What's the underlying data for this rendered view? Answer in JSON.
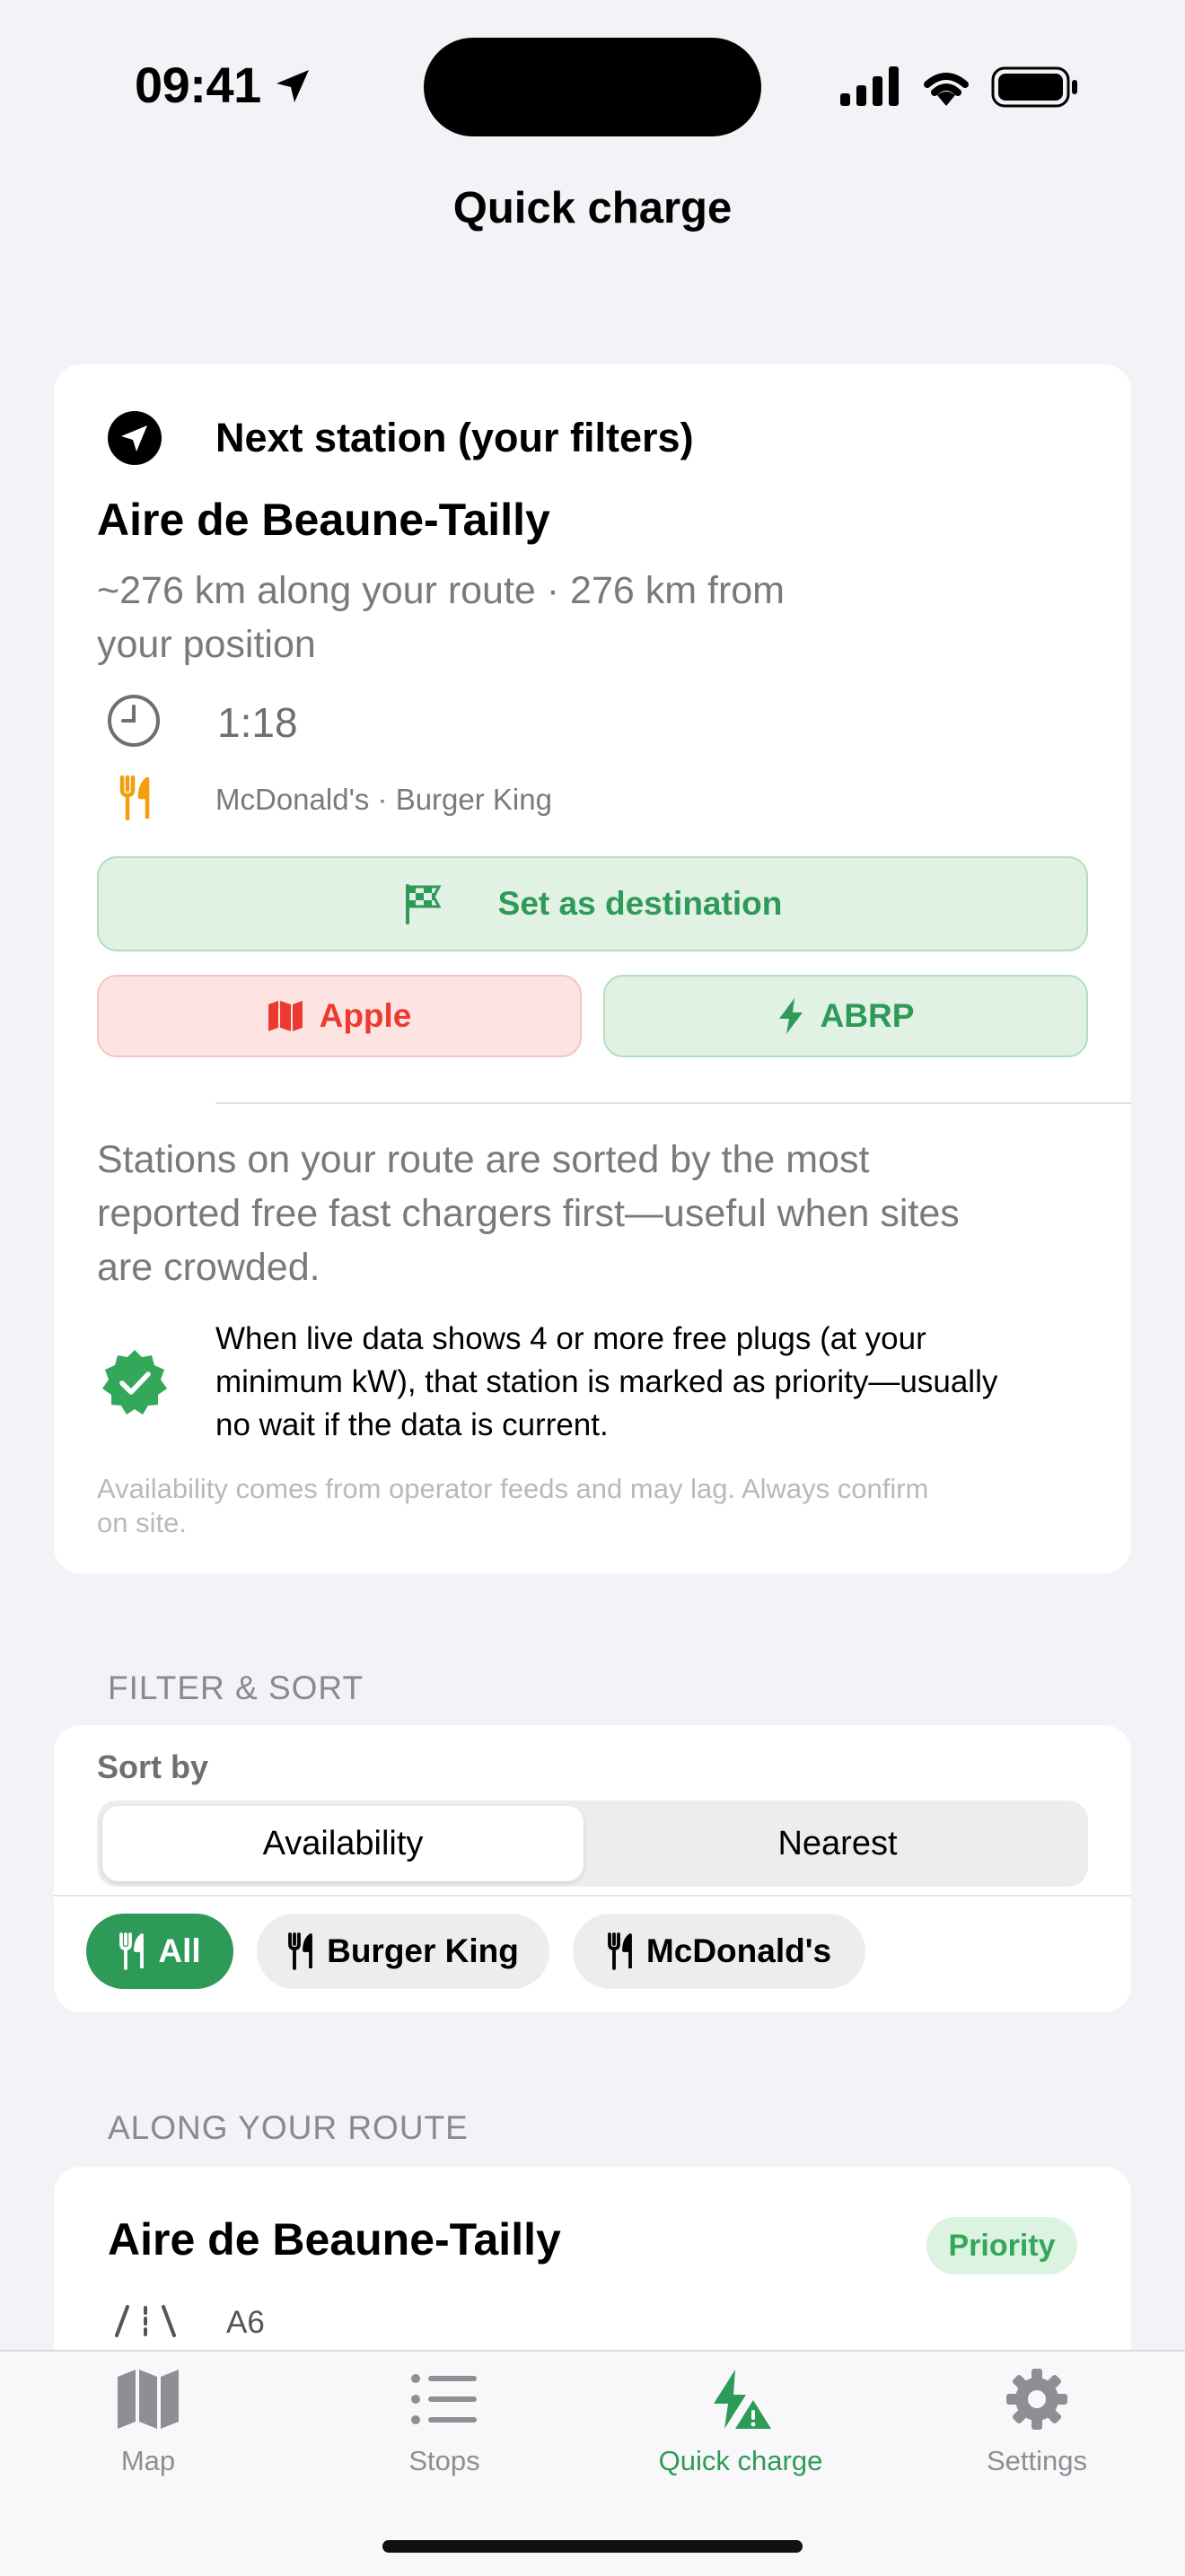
{
  "status_bar": {
    "time": "09:41"
  },
  "nav": {
    "title": "Quick charge"
  },
  "next_station": {
    "header": "Next station (your filters)",
    "name": "Aire de Beaune-Tailly",
    "distance_line1": "~276 km along your route · 276 km from",
    "distance_line2": "your position",
    "time": "1:18",
    "food": "McDonald's · Burger King",
    "set_destination_label": "Set as destination",
    "apple_label": "Apple",
    "abrp_label": "ABRP",
    "explain_line1": "Stations on your route are sorted by the most",
    "explain_line2": "reported free fast chargers first—useful when sites",
    "explain_line3": "are crowded.",
    "priority_line1": "When live data shows 4 or more free plugs (at your",
    "priority_line2": "minimum kW), that station is marked as priority—usually",
    "priority_line3": "no wait if the data is current.",
    "fine_line1": "Availability comes from operator feeds and may lag. Always confirm",
    "fine_line2": "on site."
  },
  "filter_sort": {
    "section_label": "FILTER & SORT",
    "sort_by_label": "Sort by",
    "sort_options": [
      "Availability",
      "Nearest"
    ],
    "selected_sort": "Availability",
    "chips": [
      "All",
      "Burger King",
      "McDonald's"
    ],
    "selected_chip": "All"
  },
  "route": {
    "section_label": "ALONG YOUR ROUTE",
    "stations": [
      {
        "name": "Aire de Beaune-Tailly",
        "badge": "Priority",
        "road": "A6"
      }
    ]
  },
  "tabs": [
    {
      "label": "Map",
      "icon": "map-icon"
    },
    {
      "label": "Stops",
      "icon": "list-icon"
    },
    {
      "label": "Quick charge",
      "icon": "bolt-warning-icon"
    },
    {
      "label": "Settings",
      "icon": "gear-icon"
    }
  ],
  "selected_tab": "Quick charge",
  "colors": {
    "accent": "#2E9A57",
    "danger": "#EB3B30",
    "food": "#F59E0B"
  }
}
